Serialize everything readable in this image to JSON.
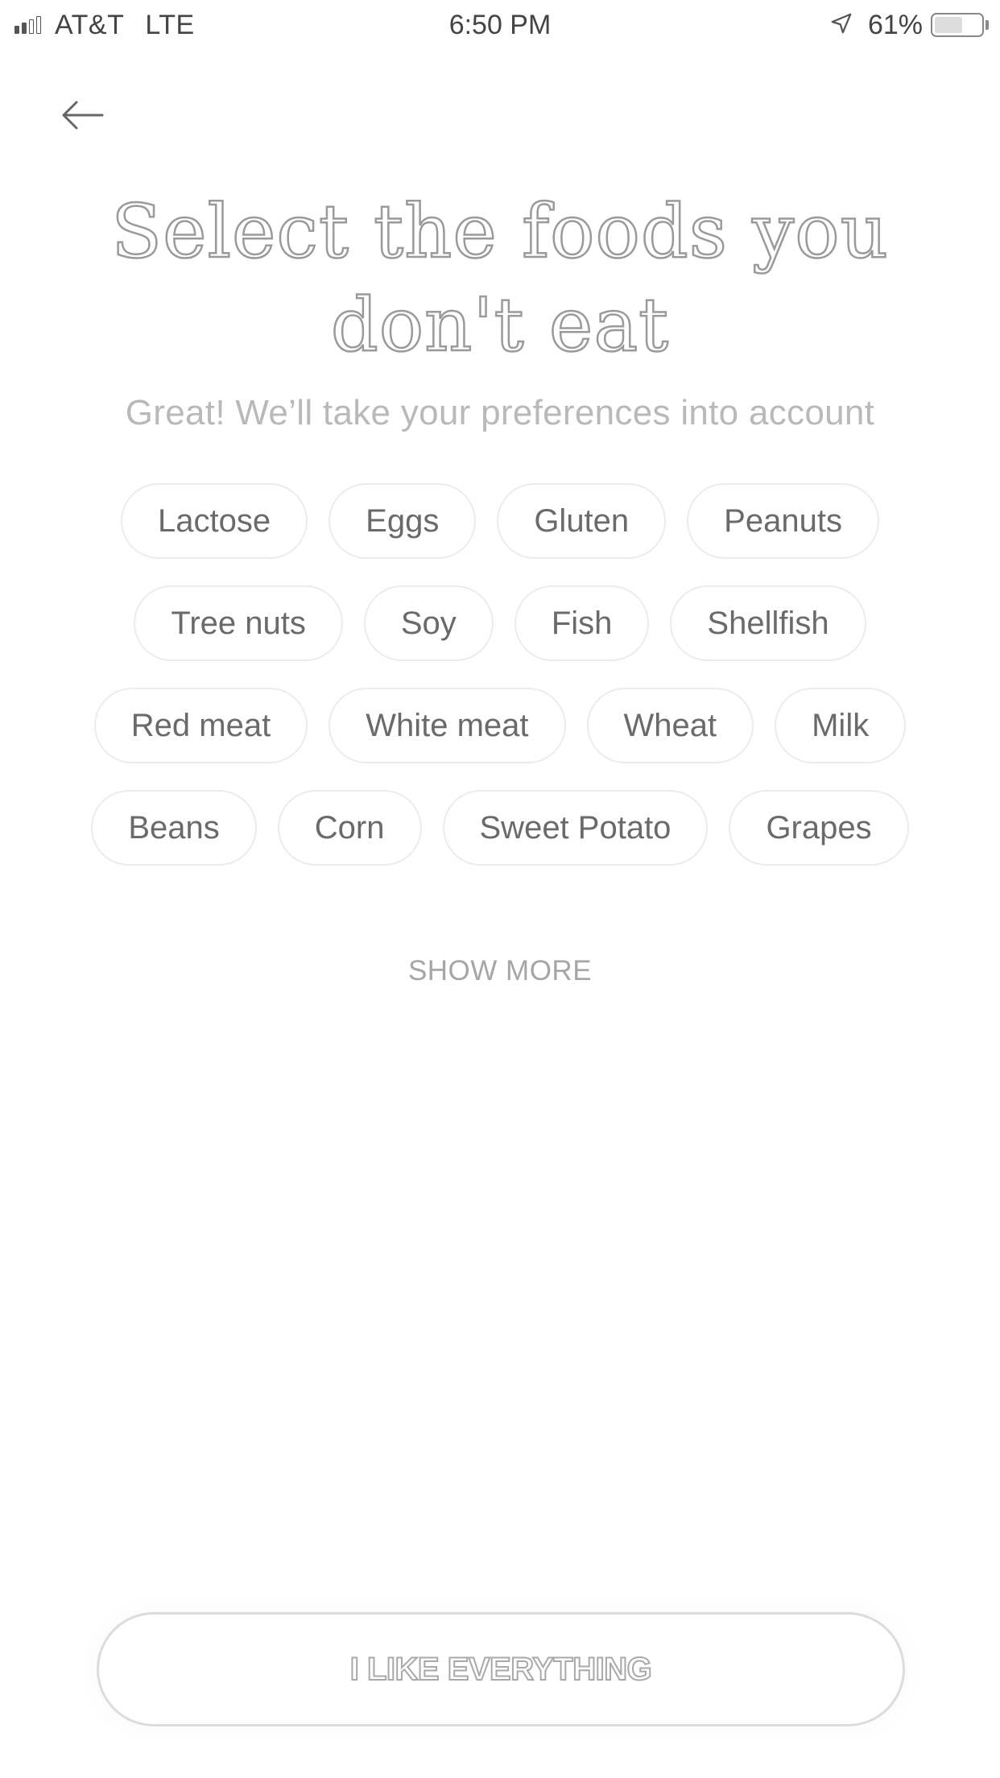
{
  "status_bar": {
    "carrier": "AT&T",
    "network": "LTE",
    "time": "6:50 PM",
    "battery_percent": "61%",
    "battery_level": 0.61,
    "signal_strength": 2,
    "signal_max": 4,
    "icons": [
      "signal-icon",
      "location-arrow-icon",
      "battery-icon"
    ]
  },
  "header": {
    "back_icon": "arrow-left-icon"
  },
  "page": {
    "title": "Select the foods you don't eat",
    "subtitle": "Great! We’ll take your preferences into account"
  },
  "chips": {
    "rows": [
      [
        "Lactose",
        "Eggs",
        "Gluten",
        "Peanuts"
      ],
      [
        "Tree nuts",
        "Soy",
        "Fish",
        "Shellfish"
      ],
      [
        "Red meat",
        "White meat",
        "Wheat",
        "Milk"
      ],
      [
        "Beans",
        "Corn",
        "Sweet Potato",
        "Grapes"
      ]
    ]
  },
  "show_more_label": "SHOW MORE",
  "cta": {
    "label": "I LIKE EVERYTHING"
  },
  "colors": {
    "background": "#ffffff",
    "chip_border": "#ececec",
    "chip_text": "#6a6a6a",
    "muted_text": "#b9b9b9",
    "title_outline": "#9a9a9a"
  }
}
